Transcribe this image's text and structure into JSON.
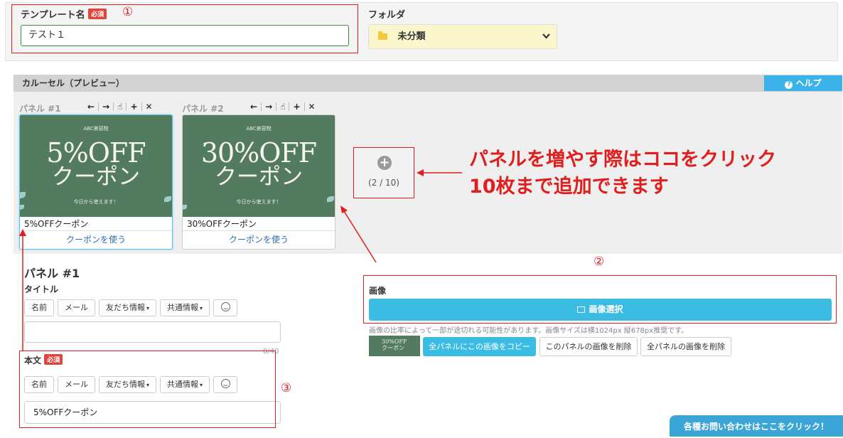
{
  "template_name": {
    "label": "テンプレート名",
    "required_badge": "必須",
    "value": "テスト１"
  },
  "folder": {
    "label": "フォルダ",
    "value": "未分類"
  },
  "carousel": {
    "header": "カルーセル（プレビュー）",
    "help_label": "ヘルプ",
    "panels": [
      {
        "label": "パネル #1",
        "image_brand": "ABC美容院",
        "image_big": "5%OFF",
        "image_big2": "クーポン",
        "image_small": "今日から使えます！",
        "title": "5%OFFクーポン",
        "action": "クーポンを使う"
      },
      {
        "label": "パネル #2",
        "image_brand": "ABC美容院",
        "image_big": "30%OFF",
        "image_big2": "クーポン",
        "image_small": "今日から使えます！",
        "title": "30%OFFクーポン",
        "action": "クーポンを使う"
      }
    ],
    "add_count": "(2 / 10)"
  },
  "annotations": {
    "num1": "①",
    "num2": "②",
    "num3": "③",
    "big_line1": "パネルを増やす際はココをクリック",
    "big_line2": "10枚まで追加できます"
  },
  "panel_editor": {
    "heading": "パネル #1",
    "title_label": "タイトル",
    "title_value": "",
    "title_counter": "0/40",
    "body_label": "本文",
    "body_required_badge": "必須",
    "body_value": "5%OFFクーポン",
    "insert_buttons": {
      "name": "名前",
      "mail": "メール",
      "friend_info": "友だち情報",
      "shared_info": "共通情報"
    }
  },
  "image_section": {
    "label": "画像",
    "select_button": "画像選択",
    "note": "画像の比率によって一部が途切れる可能性があります。画像サイズは横1024px 縦678px推奨です。",
    "thumb_text_1": "30%OFF",
    "thumb_text_2": "クーポン",
    "copy_all_button": "全パネルにこの画像をコピー",
    "delete_this_button": "このパネルの画像を削除",
    "delete_all_button": "全パネルの画像を削除"
  },
  "contact_button": "各種お問い合わせはここをクリック！",
  "colors": {
    "accent_blue": "#3bbde3",
    "annotation_red": "#e01e1e",
    "required_red": "#e0443b",
    "coupon_green": "#537b60",
    "folder_yellow": "#fcf6cc"
  },
  "icons": {
    "folder": "folder-icon",
    "dropdown": "chevron-down-icon",
    "help": "question-circle-icon",
    "move_left": "arrow-left-icon",
    "move_right": "arrow-right-icon",
    "copy": "hand-copy-icon",
    "add": "plus-icon",
    "delete": "close-icon",
    "add_panel": "plus-circle-icon",
    "emoji": "smile-icon",
    "image": "picture-icon"
  }
}
